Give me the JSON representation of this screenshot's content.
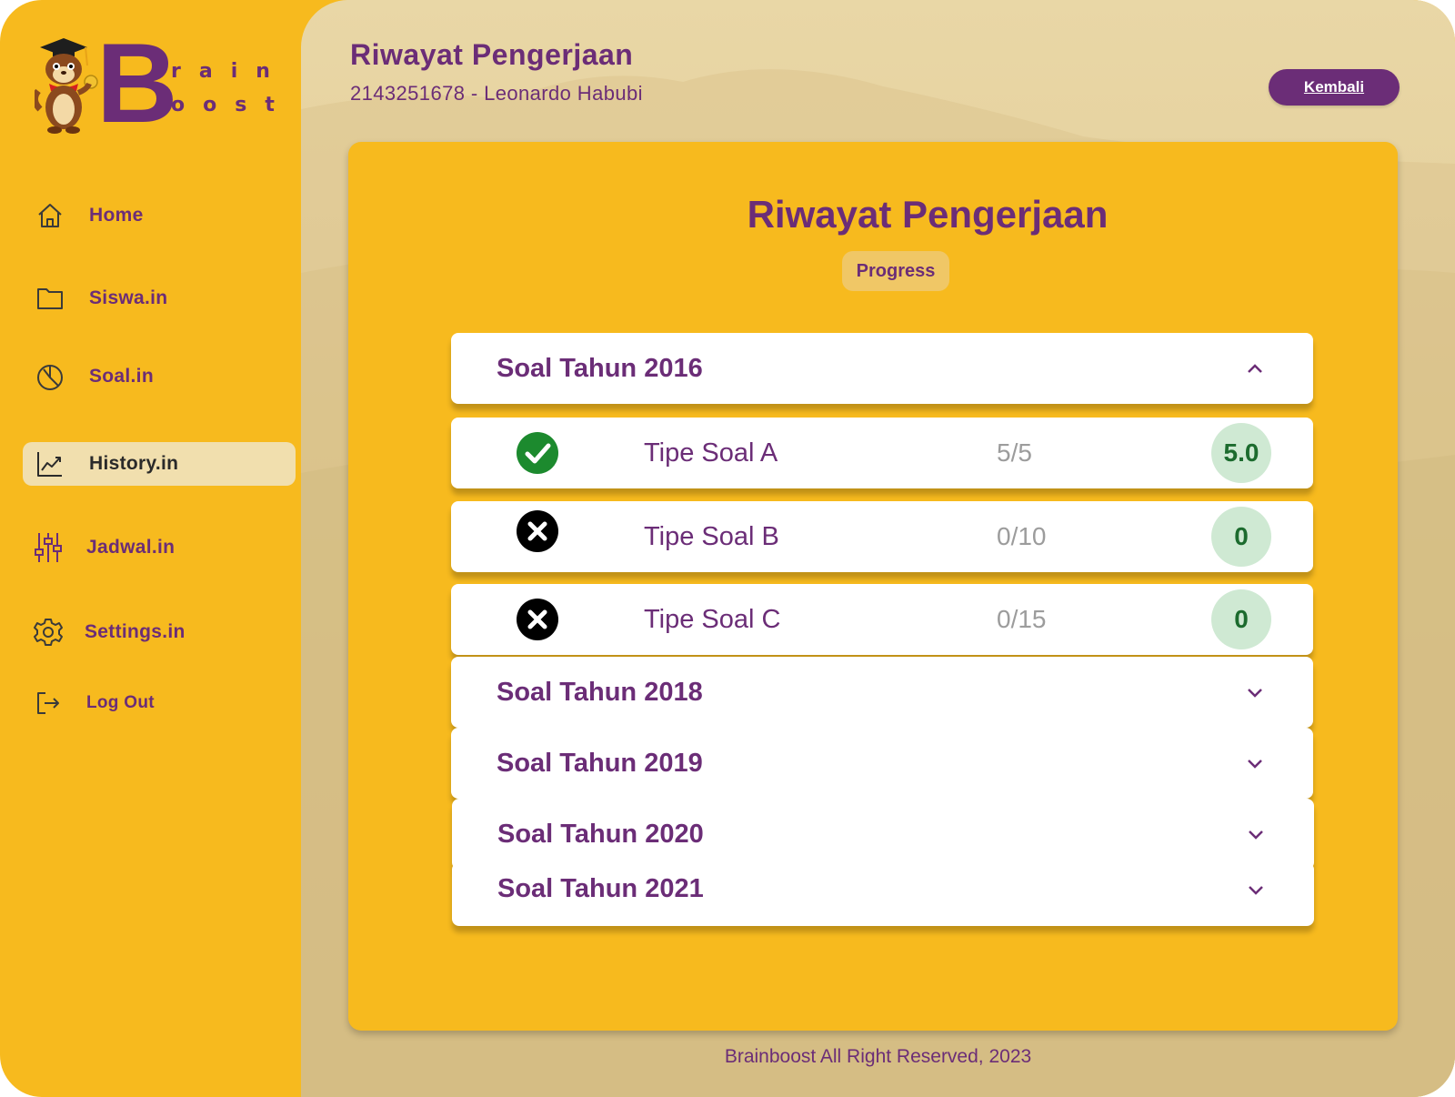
{
  "brand": {
    "letter": "B",
    "top_text": "rain",
    "bottom_text": "oost"
  },
  "sidebar": {
    "items": [
      {
        "label": "Home",
        "icon": "home-icon"
      },
      {
        "label": "Siswa.in",
        "icon": "folder-icon"
      },
      {
        "label": "Soal.in",
        "icon": "pie-chart-icon"
      },
      {
        "label": "History.in",
        "icon": "trend-chart-icon",
        "active": true
      },
      {
        "label": "Jadwal.in",
        "icon": "sliders-icon"
      },
      {
        "label": "Settings.in",
        "icon": "gear-icon"
      },
      {
        "label": "Log Out",
        "icon": "logout-icon"
      }
    ]
  },
  "header": {
    "title": "Riwayat Pengerjaan",
    "subtitle": "2143251678 - Leonardo Habubi",
    "back_label": "Kembali"
  },
  "panel": {
    "title": "Riwayat Pengerjaan",
    "tab_label": "Progress",
    "groups": [
      {
        "title": "Soal Tahun 2016",
        "expanded": true,
        "items": [
          {
            "name": "Tipe Soal A",
            "count": "5/5",
            "score": "5.0",
            "status": "check-icon"
          },
          {
            "name": "Tipe Soal B",
            "count": "0/10",
            "score": "0",
            "status": "x-icon"
          },
          {
            "name": "Tipe Soal C",
            "count": "0/15",
            "score": "0",
            "status": "x-icon"
          }
        ]
      },
      {
        "title": "Soal Tahun 2018",
        "expanded": false
      },
      {
        "title": "Soal Tahun 2019",
        "expanded": false
      },
      {
        "title": "Soal Tahun 2020",
        "expanded": false
      },
      {
        "title": "Soal Tahun 2021",
        "expanded": false
      }
    ]
  },
  "footer": {
    "text": "Brainboost All Right Reserved, 2023"
  },
  "colors": {
    "primary": "#6B2D77",
    "accent": "#F7BA1E",
    "success": "#1C8A2E",
    "badge_bg": "#CFE9D3"
  }
}
